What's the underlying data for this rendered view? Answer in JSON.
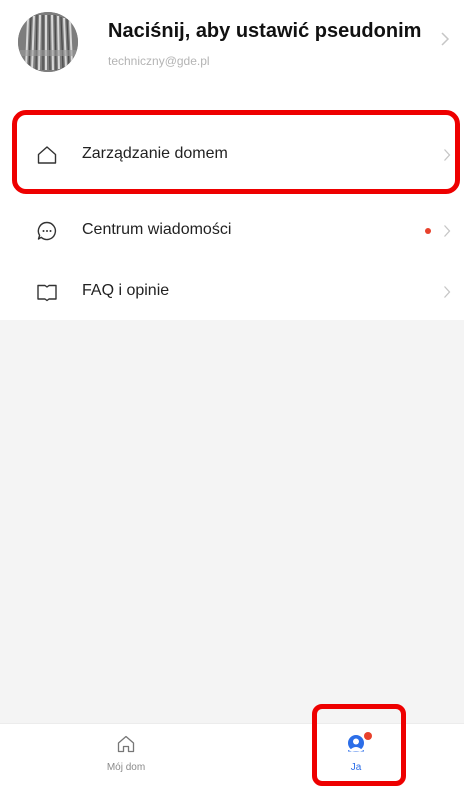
{
  "profile": {
    "name": "Naciśnij, aby ustawić pseudonim",
    "email": "techniczny@gde.pl"
  },
  "menu": [
    {
      "label": "Zarządzanie domem",
      "icon": "house-icon"
    },
    {
      "label": "Centrum wiadomości",
      "icon": "chat-bubble-icon",
      "has_unread_dot": true
    },
    {
      "label": "FAQ i opinie",
      "icon": "book-icon"
    }
  ],
  "tabs": [
    {
      "label": "Mój dom",
      "icon": "house-outline-icon",
      "active": false
    },
    {
      "label": "Ja",
      "icon": "person-icon",
      "active": true,
      "has_badge": true
    }
  ],
  "colors": {
    "accent": "#2c6ee8",
    "notification_dot": "#e8412c",
    "highlight": "#ee0000",
    "background": "#f4f4f4"
  }
}
